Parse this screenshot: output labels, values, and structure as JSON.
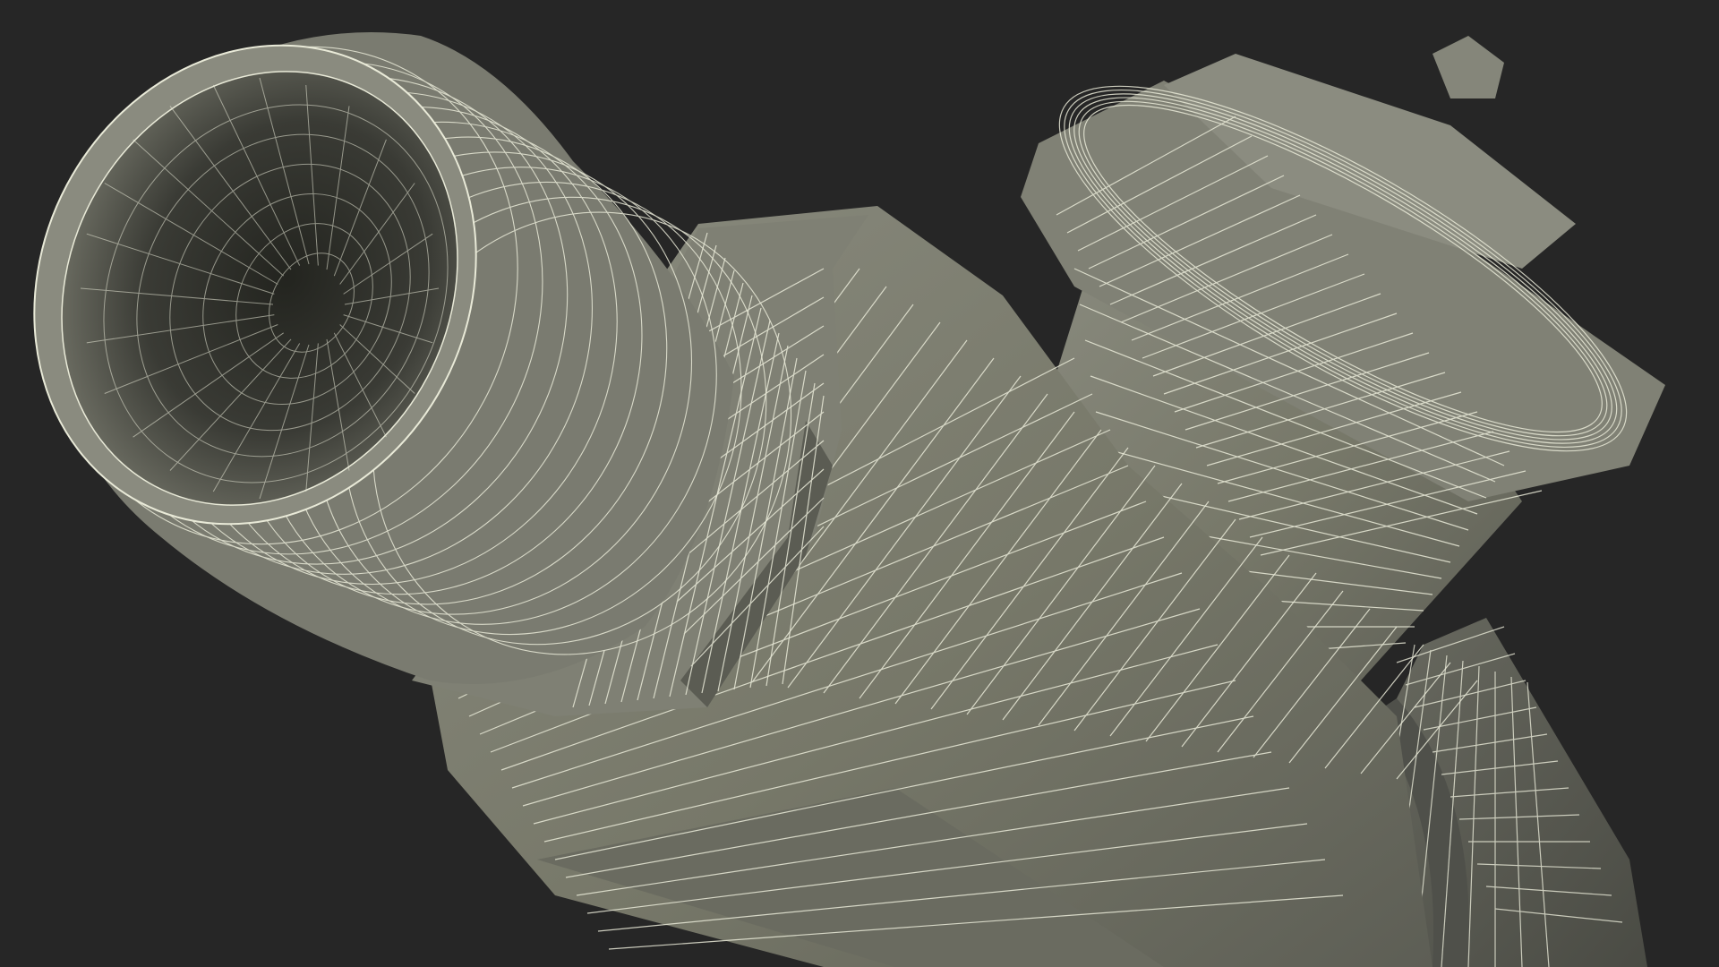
{
  "scene": {
    "subject": "wireframe-valve-model",
    "colors": {
      "background": "#262626",
      "surface": "#7b7c71",
      "surface_light": "#8d8e82",
      "surface_dark": "#55564d",
      "interior": "#2b2c27",
      "wire": "#e9ead8"
    }
  }
}
